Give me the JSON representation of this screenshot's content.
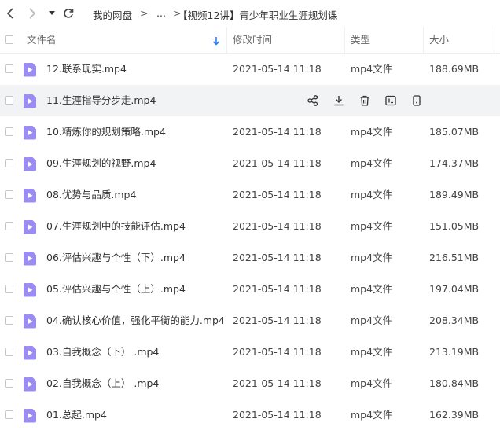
{
  "breadcrumb": {
    "root": "我的网盘",
    "sep1": ">",
    "ellipsis": "...",
    "sep2": ">",
    "current": "【视频12讲】青少年职业生涯规划课"
  },
  "columns": {
    "name": "文件名",
    "modified": "修改时间",
    "type": "类型",
    "size": "大小"
  },
  "sort_icon": "arrow-down-icon",
  "accent_color": "#2f7cf6",
  "file_icon_color": "#9b8cf2",
  "hovered_row_index": 1,
  "files": [
    {
      "name": "12.联系现实.mp4",
      "modified": "2021-05-14 11:18",
      "type": "mp4文件",
      "size": "188.69MB"
    },
    {
      "name": "11.生涯指导分步走.mp4",
      "modified": "",
      "type": "",
      "size": ""
    },
    {
      "name": "10.精炼你的规划策略.mp4",
      "modified": "2021-05-14 11:18",
      "type": "mp4文件",
      "size": "185.07MB"
    },
    {
      "name": "09.生涯规划的视野.mp4",
      "modified": "2021-05-14 11:18",
      "type": "mp4文件",
      "size": "174.37MB"
    },
    {
      "name": "08.优势与品质.mp4",
      "modified": "2021-05-14 11:18",
      "type": "mp4文件",
      "size": "189.49MB"
    },
    {
      "name": "07.生涯规划中的技能评估.mp4",
      "modified": "2021-05-14 11:18",
      "type": "mp4文件",
      "size": "151.05MB"
    },
    {
      "name": "06.评估兴趣与个性（下）.mp4",
      "modified": "2021-05-14 11:18",
      "type": "mp4文件",
      "size": "216.51MB"
    },
    {
      "name": "05.评估兴趣与个性（上）.mp4",
      "modified": "2021-05-14 11:18",
      "type": "mp4文件",
      "size": "197.04MB"
    },
    {
      "name": "04.确认核心价值，强化平衡的能力.mp4",
      "modified": "2021-05-14 11:18",
      "type": "mp4文件",
      "size": "208.34MB"
    },
    {
      "name": "03.自我概念（下） .mp4",
      "modified": "2021-05-14 11:18",
      "type": "mp4文件",
      "size": "213.19MB"
    },
    {
      "name": "02.自我概念（上） .mp4",
      "modified": "2021-05-14 11:18",
      "type": "mp4文件",
      "size": "180.84MB"
    },
    {
      "name": "01.总起.mp4",
      "modified": "2021-05-14 11:18",
      "type": "mp4文件",
      "size": "162.39MB"
    }
  ],
  "row_actions": [
    "share-icon",
    "download-icon",
    "delete-icon",
    "rename-icon",
    "more-icon"
  ]
}
